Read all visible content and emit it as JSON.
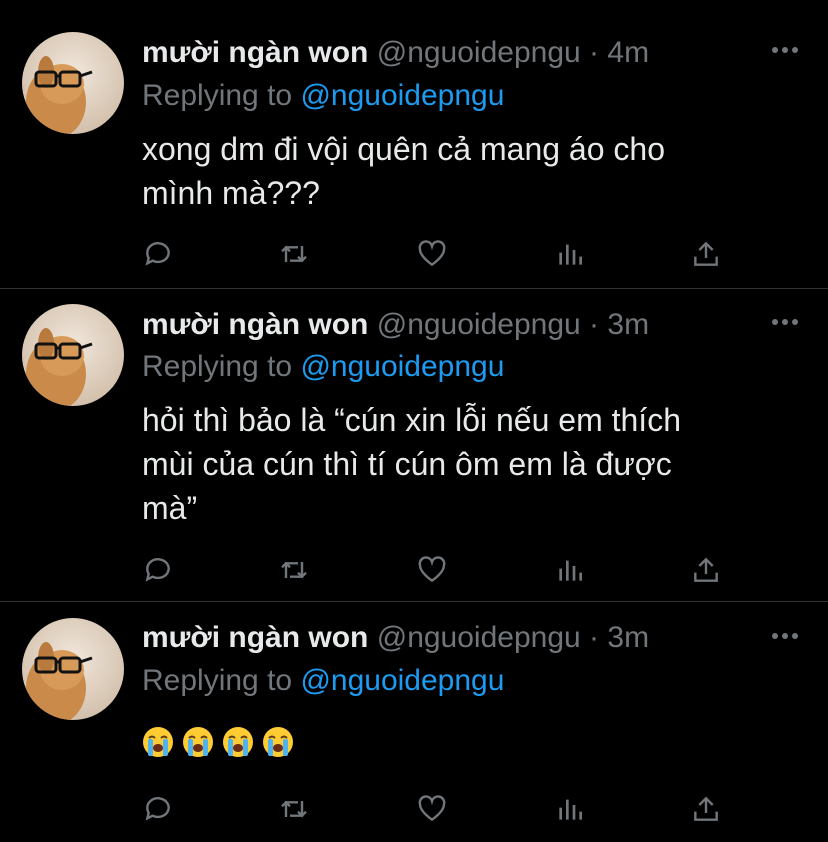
{
  "colors": {
    "background": "#000000",
    "text": "#e7e9ea",
    "muted": "#71767b",
    "accent": "#1d9bf0",
    "divider": "#2f3336"
  },
  "tweets": [
    {
      "name": "mười ngàn won",
      "handle": "@nguoidepngu",
      "sep": "·",
      "time": "4m",
      "replying_prefix": "Replying to",
      "replying_to": "@nguoidepngu",
      "text_lines": [
        "xong dm đi vội quên cả mang áo cho",
        "mình mà???"
      ]
    },
    {
      "name": "mười ngàn won",
      "handle": "@nguoidepngu",
      "sep": "·",
      "time": "3m",
      "replying_prefix": "Replying to",
      "replying_to": "@nguoidepngu",
      "text_lines": [
        "hỏi thì bảo là “cún xin lỗi nếu em thích",
        "mùi của cún thì tí cún ôm em là được",
        "mà”"
      ]
    },
    {
      "name": "mười ngàn won",
      "handle": "@nguoidepngu",
      "sep": "·",
      "time": "3m",
      "replying_prefix": "Replying to",
      "replying_to": "@nguoidepngu",
      "emoji_count": 4,
      "emoji_name": "loudly-crying-face"
    }
  ],
  "action_icons": [
    "reply-icon",
    "retweet-icon",
    "like-icon",
    "analytics-icon",
    "share-icon"
  ]
}
